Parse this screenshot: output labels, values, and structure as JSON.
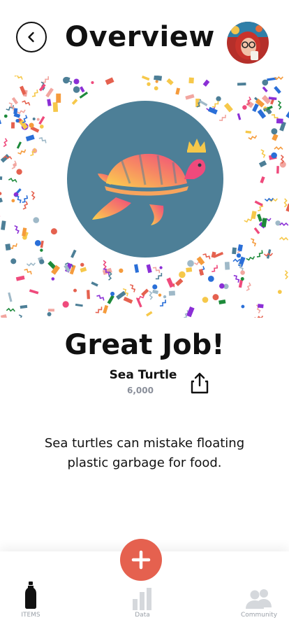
{
  "header": {
    "title": "Overview",
    "back_icon": "chevron-left-icon",
    "avatar_icon": "user-avatar"
  },
  "badge": {
    "animal": "sea-turtle-icon",
    "crown": "crown-icon",
    "circle_color": "#4d7f97"
  },
  "result": {
    "headline": "Great Job!",
    "item_name": "Sea Turtle",
    "item_count": "6,000",
    "fact": "Sea turtles can mistake floating plastic garbage for food."
  },
  "colors": {
    "accent": "#e5614f",
    "text": "#111111",
    "muted": "#9aa0a8"
  },
  "tabbar": {
    "add_icon": "plus-icon",
    "tabs": [
      {
        "label": "ITEMS",
        "icon": "bottle-icon",
        "active": true
      },
      {
        "label": "Data",
        "icon": "bar-chart-icon",
        "active": false
      },
      {
        "label": "Community",
        "icon": "people-icon",
        "active": false
      }
    ]
  }
}
